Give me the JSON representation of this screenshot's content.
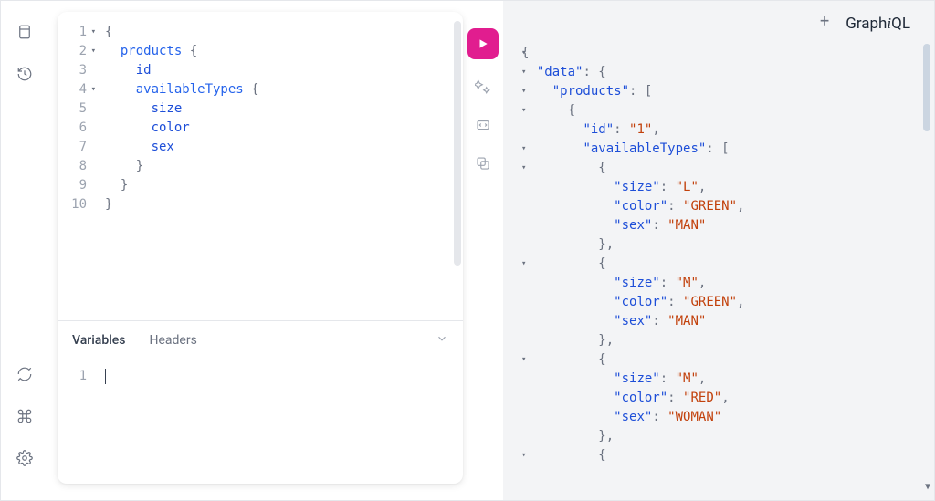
{
  "brand": {
    "prefix": "Graph",
    "italic": "i",
    "suffix": "QL"
  },
  "query": {
    "lines": [
      {
        "n": "1",
        "fold": true,
        "indent": 0,
        "tokens": [
          [
            "brace",
            "{"
          ]
        ]
      },
      {
        "n": "2",
        "fold": true,
        "indent": 1,
        "tokens": [
          [
            "field",
            "products"
          ],
          [
            "space",
            " "
          ],
          [
            "brace",
            "{"
          ]
        ]
      },
      {
        "n": "3",
        "fold": false,
        "indent": 2,
        "tokens": [
          [
            "leaf",
            "id"
          ]
        ]
      },
      {
        "n": "4",
        "fold": true,
        "indent": 2,
        "tokens": [
          [
            "field",
            "availableTypes"
          ],
          [
            "space",
            " "
          ],
          [
            "brace",
            "{"
          ]
        ]
      },
      {
        "n": "5",
        "fold": false,
        "indent": 3,
        "tokens": [
          [
            "leaf",
            "size"
          ]
        ]
      },
      {
        "n": "6",
        "fold": false,
        "indent": 3,
        "tokens": [
          [
            "leaf",
            "color"
          ]
        ]
      },
      {
        "n": "7",
        "fold": false,
        "indent": 3,
        "tokens": [
          [
            "leaf",
            "sex"
          ]
        ]
      },
      {
        "n": "8",
        "fold": false,
        "indent": 2,
        "tokens": [
          [
            "brace",
            "}"
          ]
        ]
      },
      {
        "n": "9",
        "fold": false,
        "indent": 1,
        "tokens": [
          [
            "brace",
            "}"
          ]
        ]
      },
      {
        "n": "10",
        "fold": false,
        "indent": 0,
        "tokens": [
          [
            "brace",
            "}"
          ]
        ]
      }
    ]
  },
  "tabs": {
    "variables": "Variables",
    "headers": "Headers"
  },
  "vars": {
    "lines": [
      {
        "n": "1"
      }
    ]
  },
  "result": {
    "lines": [
      {
        "indent": 0,
        "fold": true,
        "tokens": [
          [
            "punct",
            "{"
          ]
        ]
      },
      {
        "indent": 1,
        "fold": true,
        "tokens": [
          [
            "key",
            "\"data\""
          ],
          [
            "punct",
            ": {"
          ]
        ]
      },
      {
        "indent": 2,
        "fold": true,
        "tokens": [
          [
            "key",
            "\"products\""
          ],
          [
            "punct",
            ": ["
          ]
        ]
      },
      {
        "indent": 3,
        "fold": true,
        "tokens": [
          [
            "punct",
            "{"
          ]
        ]
      },
      {
        "indent": 4,
        "fold": false,
        "tokens": [
          [
            "key",
            "\"id\""
          ],
          [
            "punct",
            ": "
          ],
          [
            "str",
            "\"1\""
          ],
          [
            "punct",
            ","
          ]
        ]
      },
      {
        "indent": 4,
        "fold": true,
        "tokens": [
          [
            "key",
            "\"availableTypes\""
          ],
          [
            "punct",
            ": ["
          ]
        ]
      },
      {
        "indent": 5,
        "fold": true,
        "tokens": [
          [
            "punct",
            "{"
          ]
        ]
      },
      {
        "indent": 6,
        "fold": false,
        "tokens": [
          [
            "key",
            "\"size\""
          ],
          [
            "punct",
            ": "
          ],
          [
            "str",
            "\"L\""
          ],
          [
            "punct",
            ","
          ]
        ]
      },
      {
        "indent": 6,
        "fold": false,
        "tokens": [
          [
            "key",
            "\"color\""
          ],
          [
            "punct",
            ": "
          ],
          [
            "str",
            "\"GREEN\""
          ],
          [
            "punct",
            ","
          ]
        ]
      },
      {
        "indent": 6,
        "fold": false,
        "tokens": [
          [
            "key",
            "\"sex\""
          ],
          [
            "punct",
            ": "
          ],
          [
            "str",
            "\"MAN\""
          ]
        ]
      },
      {
        "indent": 5,
        "fold": false,
        "tokens": [
          [
            "punct",
            "},"
          ]
        ]
      },
      {
        "indent": 5,
        "fold": true,
        "tokens": [
          [
            "punct",
            "{"
          ]
        ]
      },
      {
        "indent": 6,
        "fold": false,
        "tokens": [
          [
            "key",
            "\"size\""
          ],
          [
            "punct",
            ": "
          ],
          [
            "str",
            "\"M\""
          ],
          [
            "punct",
            ","
          ]
        ]
      },
      {
        "indent": 6,
        "fold": false,
        "tokens": [
          [
            "key",
            "\"color\""
          ],
          [
            "punct",
            ": "
          ],
          [
            "str",
            "\"GREEN\""
          ],
          [
            "punct",
            ","
          ]
        ]
      },
      {
        "indent": 6,
        "fold": false,
        "tokens": [
          [
            "key",
            "\"sex\""
          ],
          [
            "punct",
            ": "
          ],
          [
            "str",
            "\"MAN\""
          ]
        ]
      },
      {
        "indent": 5,
        "fold": false,
        "tokens": [
          [
            "punct",
            "},"
          ]
        ]
      },
      {
        "indent": 5,
        "fold": true,
        "tokens": [
          [
            "punct",
            "{"
          ]
        ]
      },
      {
        "indent": 6,
        "fold": false,
        "tokens": [
          [
            "key",
            "\"size\""
          ],
          [
            "punct",
            ": "
          ],
          [
            "str",
            "\"M\""
          ],
          [
            "punct",
            ","
          ]
        ]
      },
      {
        "indent": 6,
        "fold": false,
        "tokens": [
          [
            "key",
            "\"color\""
          ],
          [
            "punct",
            ": "
          ],
          [
            "str",
            "\"RED\""
          ],
          [
            "punct",
            ","
          ]
        ]
      },
      {
        "indent": 6,
        "fold": false,
        "tokens": [
          [
            "key",
            "\"sex\""
          ],
          [
            "punct",
            ": "
          ],
          [
            "str",
            "\"WOMAN\""
          ]
        ]
      },
      {
        "indent": 5,
        "fold": false,
        "tokens": [
          [
            "punct",
            "},"
          ]
        ]
      },
      {
        "indent": 5,
        "fold": true,
        "tokens": [
          [
            "punct",
            "{"
          ]
        ]
      }
    ]
  }
}
